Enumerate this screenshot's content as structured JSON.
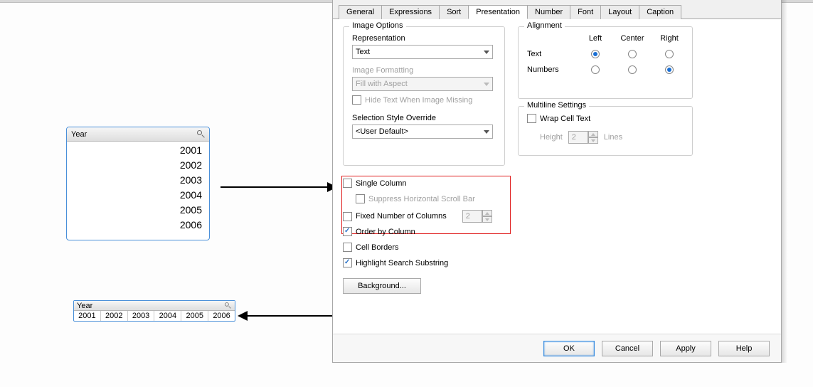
{
  "tabs": {
    "general": "General",
    "expressions": "Expressions",
    "sort": "Sort",
    "presentation": "Presentation",
    "number": "Number",
    "font": "Font",
    "layout": "Layout",
    "caption": "Caption"
  },
  "image_options": {
    "title": "Image Options",
    "representation_label": "Representation",
    "representation_value": "Text",
    "formatting_label": "Image Formatting",
    "formatting_value": "Fill with Aspect",
    "hide_missing_label": "Hide Text When Image Missing",
    "selection_style_label": "Selection Style Override",
    "selection_style_value": "<User Default>"
  },
  "column_opts": {
    "single_column": "Single Column",
    "suppress_hscroll": "Suppress Horizontal Scroll Bar",
    "fixed_cols": "Fixed Number of Columns",
    "fixed_cols_value": "2",
    "order_by_column": "Order by Column",
    "cell_borders": "Cell Borders",
    "highlight_search": "Highlight Search Substring",
    "background_btn": "Background..."
  },
  "alignment": {
    "title": "Alignment",
    "left": "Left",
    "center": "Center",
    "right": "Right",
    "text_row": "Text",
    "numbers_row": "Numbers"
  },
  "multiline": {
    "title": "Multiline Settings",
    "wrap": "Wrap Cell Text",
    "height_label": "Height",
    "height_value": "2",
    "lines": "Lines"
  },
  "buttons": {
    "ok": "OK",
    "cancel": "Cancel",
    "apply": "Apply",
    "help": "Help"
  },
  "year_listbox": {
    "title": "Year",
    "items": [
      "2001",
      "2002",
      "2003",
      "2004",
      "2005",
      "2006"
    ]
  }
}
